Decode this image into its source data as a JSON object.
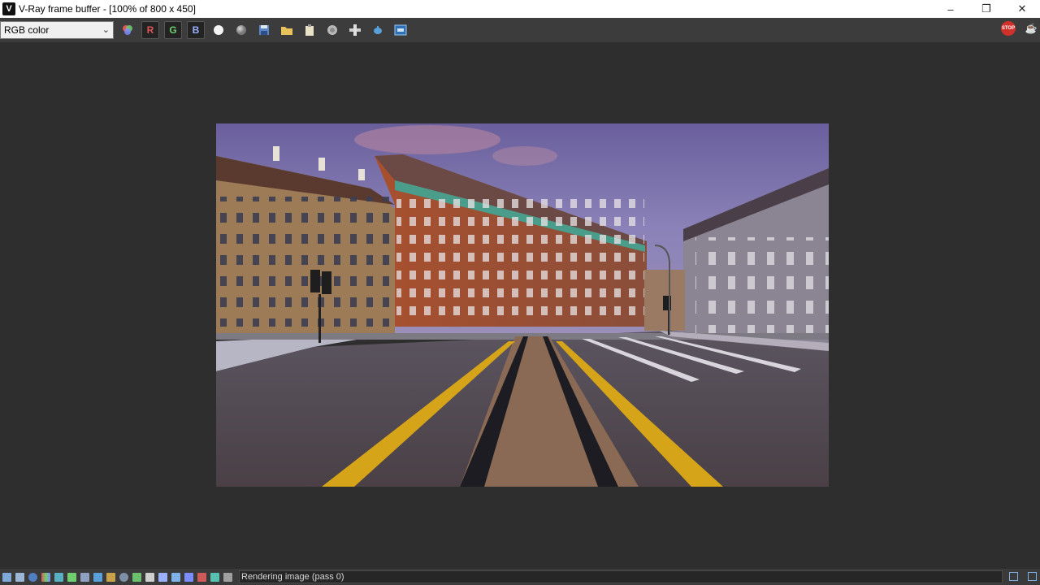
{
  "window": {
    "title": "V-Ray frame buffer - [100% of 800 x 450]",
    "icon_letter": "V",
    "controls": {
      "minimize": "–",
      "restore": "❐",
      "close": "✕"
    }
  },
  "toolbar": {
    "channel_select": {
      "value": "RGB color"
    },
    "channels": {
      "r": "R",
      "g": "G",
      "b": "B"
    },
    "colors": {
      "r": "#e05555",
      "g": "#6fcf6f",
      "b": "#9ab0ff",
      "stop": "#d0302a"
    },
    "icons": [
      "color-balls-icon",
      "red-channel",
      "green-channel",
      "blue-channel",
      "white-sphere-icon",
      "gray-sphere-icon",
      "save-icon",
      "folder-icon",
      "clipboard-icon",
      "circle-icon",
      "link-icon",
      "teapot-icon",
      "vfb-icon"
    ],
    "stop_label": "STOP"
  },
  "status": {
    "text": "Rendering image (pass 0)"
  }
}
